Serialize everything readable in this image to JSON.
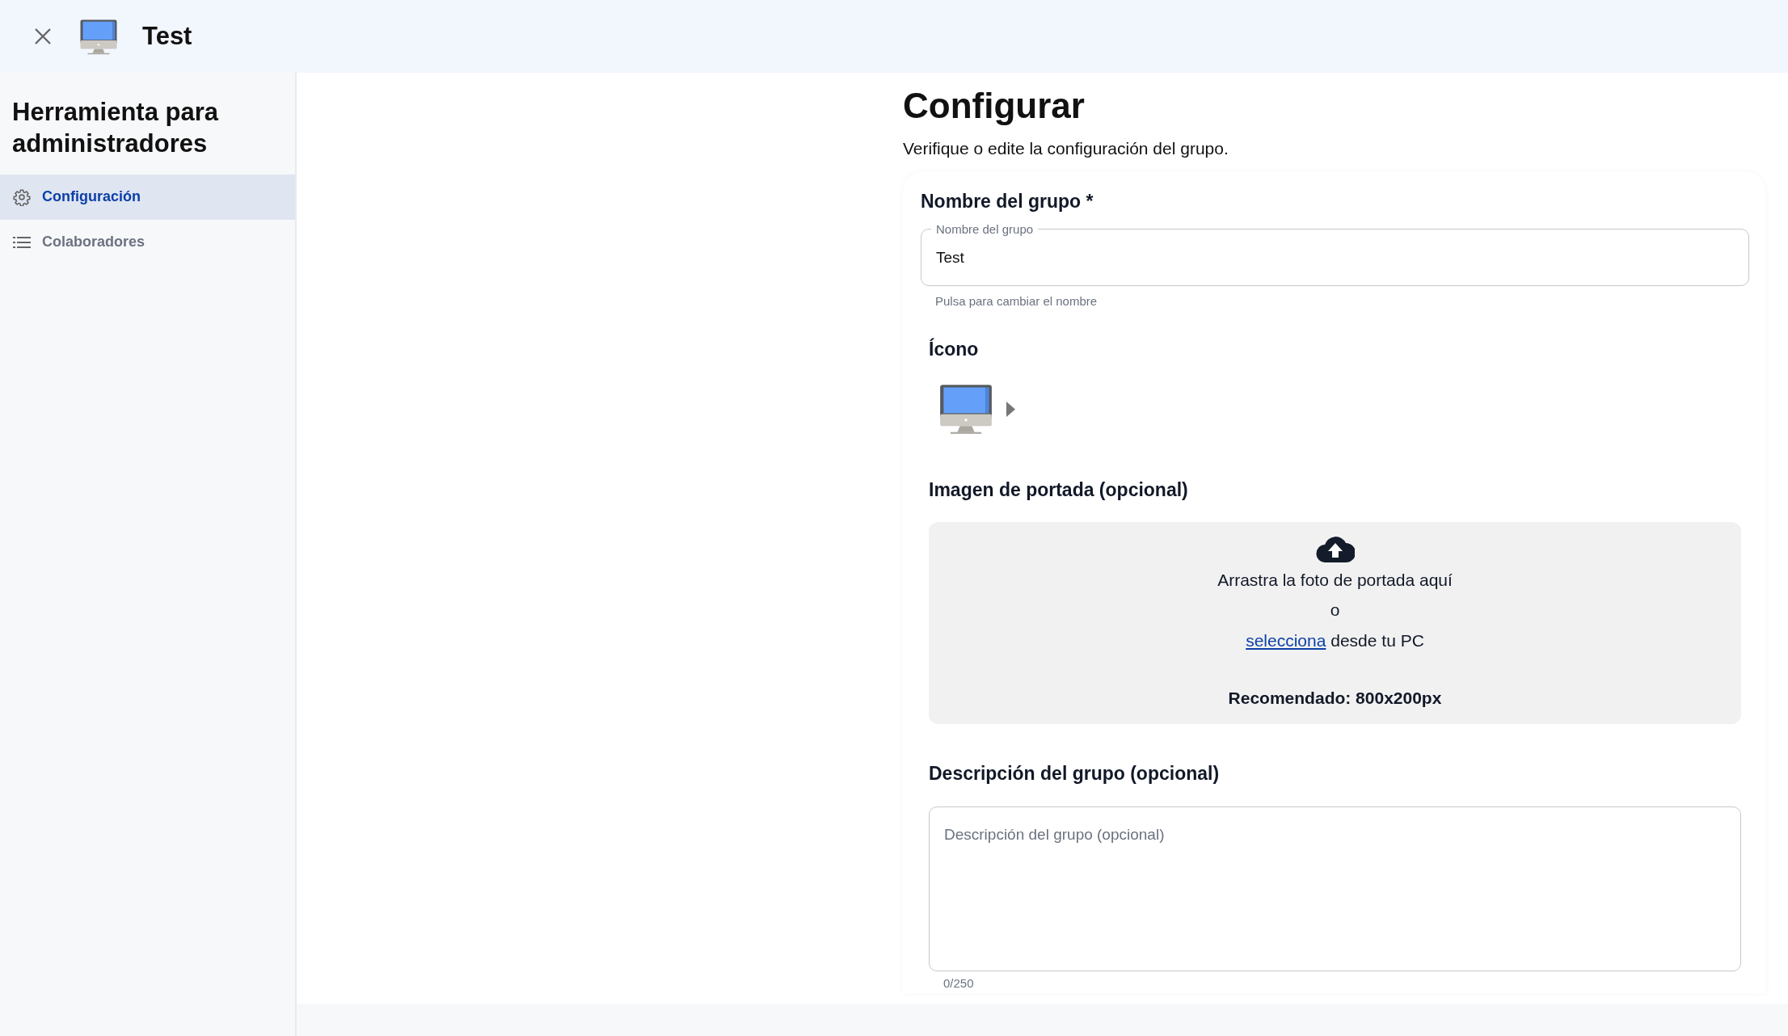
{
  "header": {
    "title": "Test"
  },
  "sidebar": {
    "title": "Herramienta para administradores",
    "items": [
      {
        "label": "Configuración",
        "kind": "gear",
        "selected": true
      },
      {
        "label": "Colaboradores",
        "kind": "list",
        "selected": false
      }
    ]
  },
  "main": {
    "title": "Configurar",
    "subtitle": "Verifique o edite la configuración del grupo.",
    "name_section": {
      "label": "Nombre del grupo *",
      "field_label": "Nombre del grupo",
      "value": "Test",
      "help": "Pulsa para cambiar el nombre"
    },
    "icon_section": {
      "label": "Ícono"
    },
    "cover_section": {
      "label": "Imagen de portada (opcional)",
      "drop_text": "Arrastra la foto de portada aquí",
      "or_text": "o",
      "link": "selecciona",
      "link_suffix": "desde tu PC",
      "recommendation": "Recomendado: 800x200px"
    },
    "description_section": {
      "label": "Descripción del grupo (opcional)",
      "placeholder": "Descripción del grupo (opcional)",
      "counter": "0/250"
    }
  }
}
